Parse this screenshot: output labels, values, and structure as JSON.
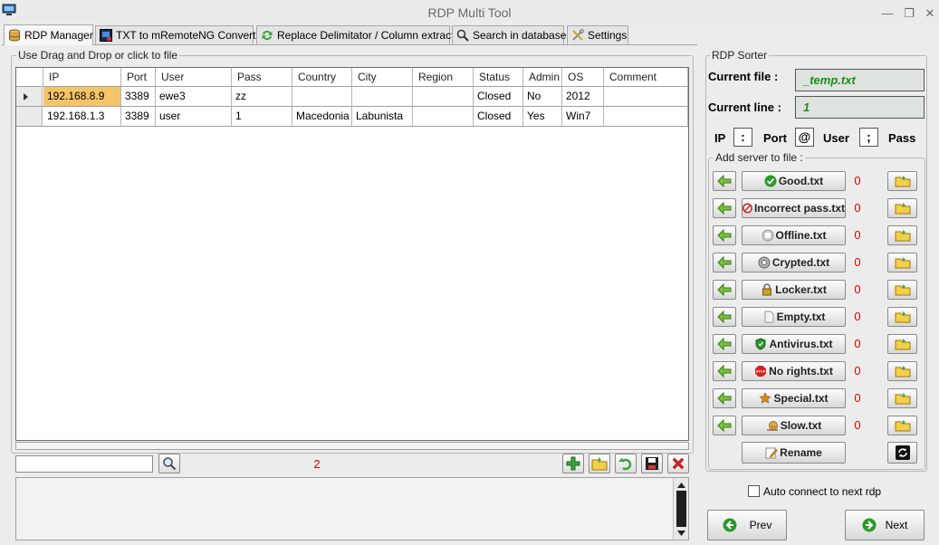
{
  "window": {
    "title": "RDP Multi Tool",
    "minimize": "—",
    "restore": "❐",
    "close": "✕"
  },
  "tabs": [
    {
      "label": "RDP Manager",
      "icon": "database-icon"
    },
    {
      "label": "TXT to mRemoteNG Converter",
      "icon": "converter-icon"
    },
    {
      "label": "Replace Delimitator / Column extractor",
      "icon": "refresh-icon"
    },
    {
      "label": "Search in database",
      "icon": "search-icon"
    },
    {
      "label": "Settings",
      "icon": "tools-icon"
    }
  ],
  "left": {
    "group_label": "Use Drag and Drop or click to file",
    "columns": [
      "IP",
      "Port",
      "User",
      "Pass",
      "Country",
      "City",
      "Region",
      "Status",
      "Admin",
      "OS",
      "Comment"
    ],
    "rows": [
      [
        "192.168.8.9",
        "3389",
        "ewe3",
        "zz",
        "",
        "",
        "",
        "Closed",
        "No",
        "2012",
        ""
      ],
      [
        "192.168.1.3",
        "3389",
        "user",
        "1",
        "Macedonia",
        "Labunista",
        "",
        "Closed",
        "Yes",
        "Win7",
        ""
      ]
    ],
    "filter_value": "",
    "count": "2"
  },
  "right": {
    "group_label": "RDP Sorter",
    "current_file_label": "Current file :",
    "current_file_value": "_temp.txt",
    "current_line_label": "Current line :",
    "current_line_value": "1",
    "delim": {
      "ip_label": "IP",
      "ip_sep": ":",
      "port_label": "Port",
      "port_sep": "@",
      "user_label": "User",
      "user_sep": ";",
      "pass_label": "Pass"
    },
    "add_group_label": "Add server to file :",
    "files": [
      {
        "label": "Good.txt",
        "count": "0",
        "icon": "check-icon",
        "color": "#2a9a2a"
      },
      {
        "label": "Incorrect pass.txt",
        "count": "0",
        "icon": "forbidden-icon",
        "color": "#d42020"
      },
      {
        "label": "Offline.txt",
        "count": "0",
        "icon": "offline-icon",
        "color": "#cccccc"
      },
      {
        "label": "Crypted.txt",
        "count": "0",
        "icon": "crypted-icon",
        "color": "#b0b0b0"
      },
      {
        "label": "Locker.txt",
        "count": "0",
        "icon": "lock-icon",
        "color": "#c9a227"
      },
      {
        "label": "Empty.txt",
        "count": "0",
        "icon": "empty-icon",
        "color": "#f2f2f2"
      },
      {
        "label": "Antivirus.txt",
        "count": "0",
        "icon": "shield-icon",
        "color": "#2a9a2a"
      },
      {
        "label": "No rights.txt",
        "count": "0",
        "icon": "stop-icon",
        "color": "#d42020"
      },
      {
        "label": "Special.txt",
        "count": "0",
        "icon": "special-icon",
        "color": "#e08a10"
      },
      {
        "label": "Slow.txt",
        "count": "0",
        "icon": "snail-icon",
        "color": "#9a6a2a"
      }
    ],
    "rename_label": "Rename",
    "auto_connect_label": "Auto connect to next rdp",
    "auto_connect_checked": false,
    "prev_label": "Prev",
    "next_label": "Next"
  }
}
